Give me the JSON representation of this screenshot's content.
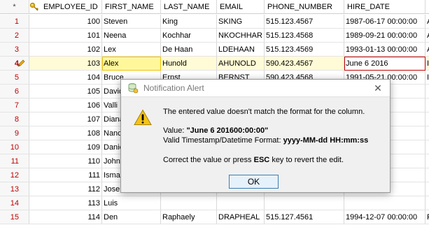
{
  "columns": {
    "rownum": "*",
    "employee_id": "EMPLOYEE_ID",
    "first_name": "FIRST_NAME",
    "last_name": "LAST_NAME",
    "email": "EMAIL",
    "phone": "PHONE_NUMBER",
    "hire_date": "HIRE_DATE"
  },
  "rows": [
    {
      "n": "1",
      "id": "100",
      "first": "Steven",
      "last": "King",
      "email": "SKING",
      "phone": "515.123.4567",
      "hire": "1987-06-17 00:00:00",
      "extra": "A"
    },
    {
      "n": "2",
      "id": "101",
      "first": "Neena",
      "last": "Kochhar",
      "email": "NKOCHHAR",
      "phone": "515.123.4568",
      "hire": "1989-09-21 00:00:00",
      "extra": "A"
    },
    {
      "n": "3",
      "id": "102",
      "first": "Lex",
      "last": "De Haan",
      "email": "LDEHAAN",
      "phone": "515.123.4569",
      "hire": "1993-01-13 00:00:00",
      "extra": "A"
    },
    {
      "n": "4",
      "id": "103",
      "first": "Alex",
      "last": "Hunold",
      "email": "AHUNOLD",
      "phone": "590.423.4567",
      "hire": "June 6 2016",
      "extra": "I"
    },
    {
      "n": "5",
      "id": "104",
      "first": "Bruce",
      "last": "Ernst",
      "email": "BERNST",
      "phone": "590.423.4568",
      "hire": "1991-05-21 00:00:00",
      "extra": "I"
    },
    {
      "n": "6",
      "id": "105",
      "first": "David",
      "last": "",
      "email": "",
      "phone": "",
      "hire": "",
      "extra": ""
    },
    {
      "n": "7",
      "id": "106",
      "first": "Valli",
      "last": "",
      "email": "",
      "phone": "",
      "hire": "",
      "extra": ""
    },
    {
      "n": "8",
      "id": "107",
      "first": "Diana",
      "last": "",
      "email": "",
      "phone": "",
      "hire": "",
      "extra": ""
    },
    {
      "n": "9",
      "id": "108",
      "first": "Nancy",
      "last": "",
      "email": "",
      "phone": "",
      "hire": "",
      "extra": ""
    },
    {
      "n": "10",
      "id": "109",
      "first": "Daniel",
      "last": "",
      "email": "",
      "phone": "",
      "hire": "",
      "extra": ""
    },
    {
      "n": "11",
      "id": "110",
      "first": "John",
      "last": "",
      "email": "",
      "phone": "",
      "hire": "",
      "extra": ""
    },
    {
      "n": "12",
      "id": "111",
      "first": "Ismael",
      "last": "",
      "email": "",
      "phone": "",
      "hire": "",
      "extra": ""
    },
    {
      "n": "13",
      "id": "112",
      "first": "Jose",
      "last": "",
      "email": "",
      "phone": "",
      "hire": "",
      "extra": ""
    },
    {
      "n": "14",
      "id": "113",
      "first": "Luis",
      "last": "",
      "email": "",
      "phone": "",
      "hire": "",
      "extra": ""
    },
    {
      "n": "15",
      "id": "114",
      "first": "Den",
      "last": "Raphaely",
      "email": "DRAPHEAL",
      "phone": "515.127.4561",
      "hire": "1994-12-07 00:00:00",
      "extra": "F"
    }
  ],
  "dialog": {
    "title": "Notification Alert",
    "close": "✕",
    "message": "The entered value doesn't match the format for the column.",
    "value_label": "Value:",
    "value": "\"June 6 201600:00:00\"",
    "format_label": "Valid Timestamp/Datetime Format:",
    "format": "yyyy-MM-dd HH:mm:ss",
    "hint_prefix": "Correct the value or press",
    "hint_key": "ESC",
    "hint_suffix": "key to revert the edit.",
    "ok_label": "OK"
  },
  "icons": {
    "key": "key-icon",
    "pencil": "pencil-icon",
    "warning": "warning-icon",
    "app": "database-icon"
  }
}
